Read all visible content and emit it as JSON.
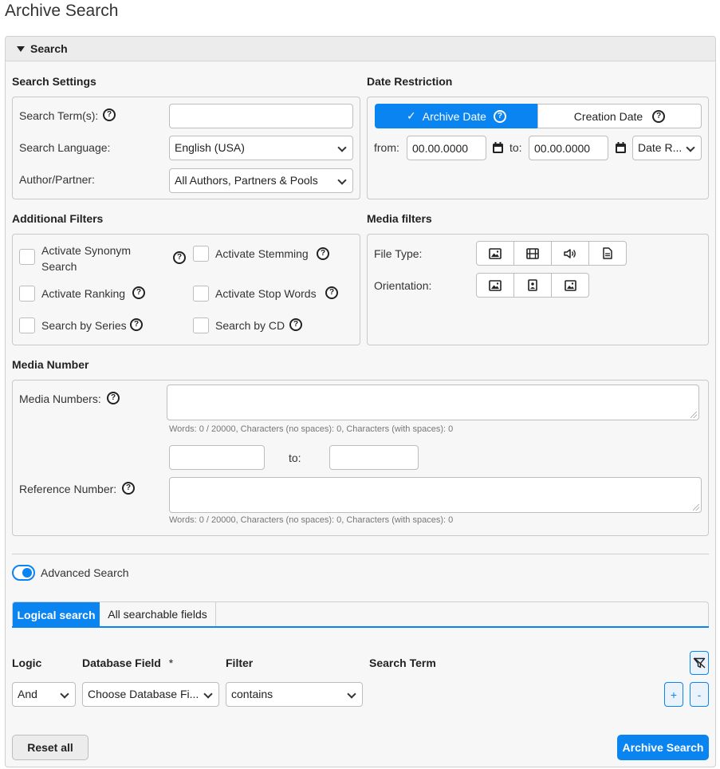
{
  "page": {
    "title": "Archive Search"
  },
  "panel": {
    "header": "Search"
  },
  "search_settings": {
    "title": "Search Settings",
    "term_label": "Search Term(s):",
    "term_value": "",
    "language_label": "Search Language:",
    "language_value": "English (USA)",
    "author_label": "Author/Partner:",
    "author_value": "All Authors, Partners & Pools"
  },
  "date_restriction": {
    "title": "Date Restriction",
    "tab_archive": "Archive Date",
    "tab_creation": "Creation Date",
    "from_label": "from:",
    "from_value": "00.00.0000",
    "to_label": "to:",
    "to_value": "00.00.0000",
    "range_value": "Date R..."
  },
  "additional_filters": {
    "title": "Additional Filters",
    "synonym_line1": "Activate Synonym",
    "synonym_line2": "Search",
    "stemming": "Activate Stemming",
    "ranking": "Activate Ranking",
    "stop_words": "Activate Stop Words",
    "series": "Search by Series",
    "cd": "Search by CD"
  },
  "media_filters": {
    "title": "Media filters",
    "file_type_label": "File Type:",
    "orientation_label": "Orientation:",
    "file_type_icons": [
      "image-icon",
      "film-icon",
      "audio-icon",
      "document-icon"
    ],
    "orientation_icons": [
      "landscape-icon",
      "portrait-icon",
      "square-icon"
    ]
  },
  "media_number": {
    "title": "Media Number",
    "numbers_label": "Media Numbers:",
    "numbers_hint": "Words: 0 / 20000, Characters (no spaces): 0, Characters (with spaces): 0",
    "range_to": "to:",
    "reference_label": "Reference Number:",
    "reference_hint": "Words: 0 / 20000, Characters (no spaces): 0, Characters (with spaces): 0"
  },
  "advanced": {
    "toggle_label": "Advanced Search",
    "tab_logical": "Logical search",
    "tab_fields": "All searchable fields",
    "col_logic": "Logic",
    "col_field": "Database Field",
    "col_field_required": "*",
    "col_filter": "Filter",
    "col_term": "Search Term",
    "logic_value": "And",
    "field_value": "Choose Database Fi...",
    "filter_value": "contains",
    "add_label": "+",
    "remove_label": "-"
  },
  "actions": {
    "reset": "Reset all",
    "search": "Archive Search"
  },
  "colors": {
    "accent": "#0a84f0",
    "panel_bg": "#f7f7f7",
    "border": "#c9c9c9"
  }
}
